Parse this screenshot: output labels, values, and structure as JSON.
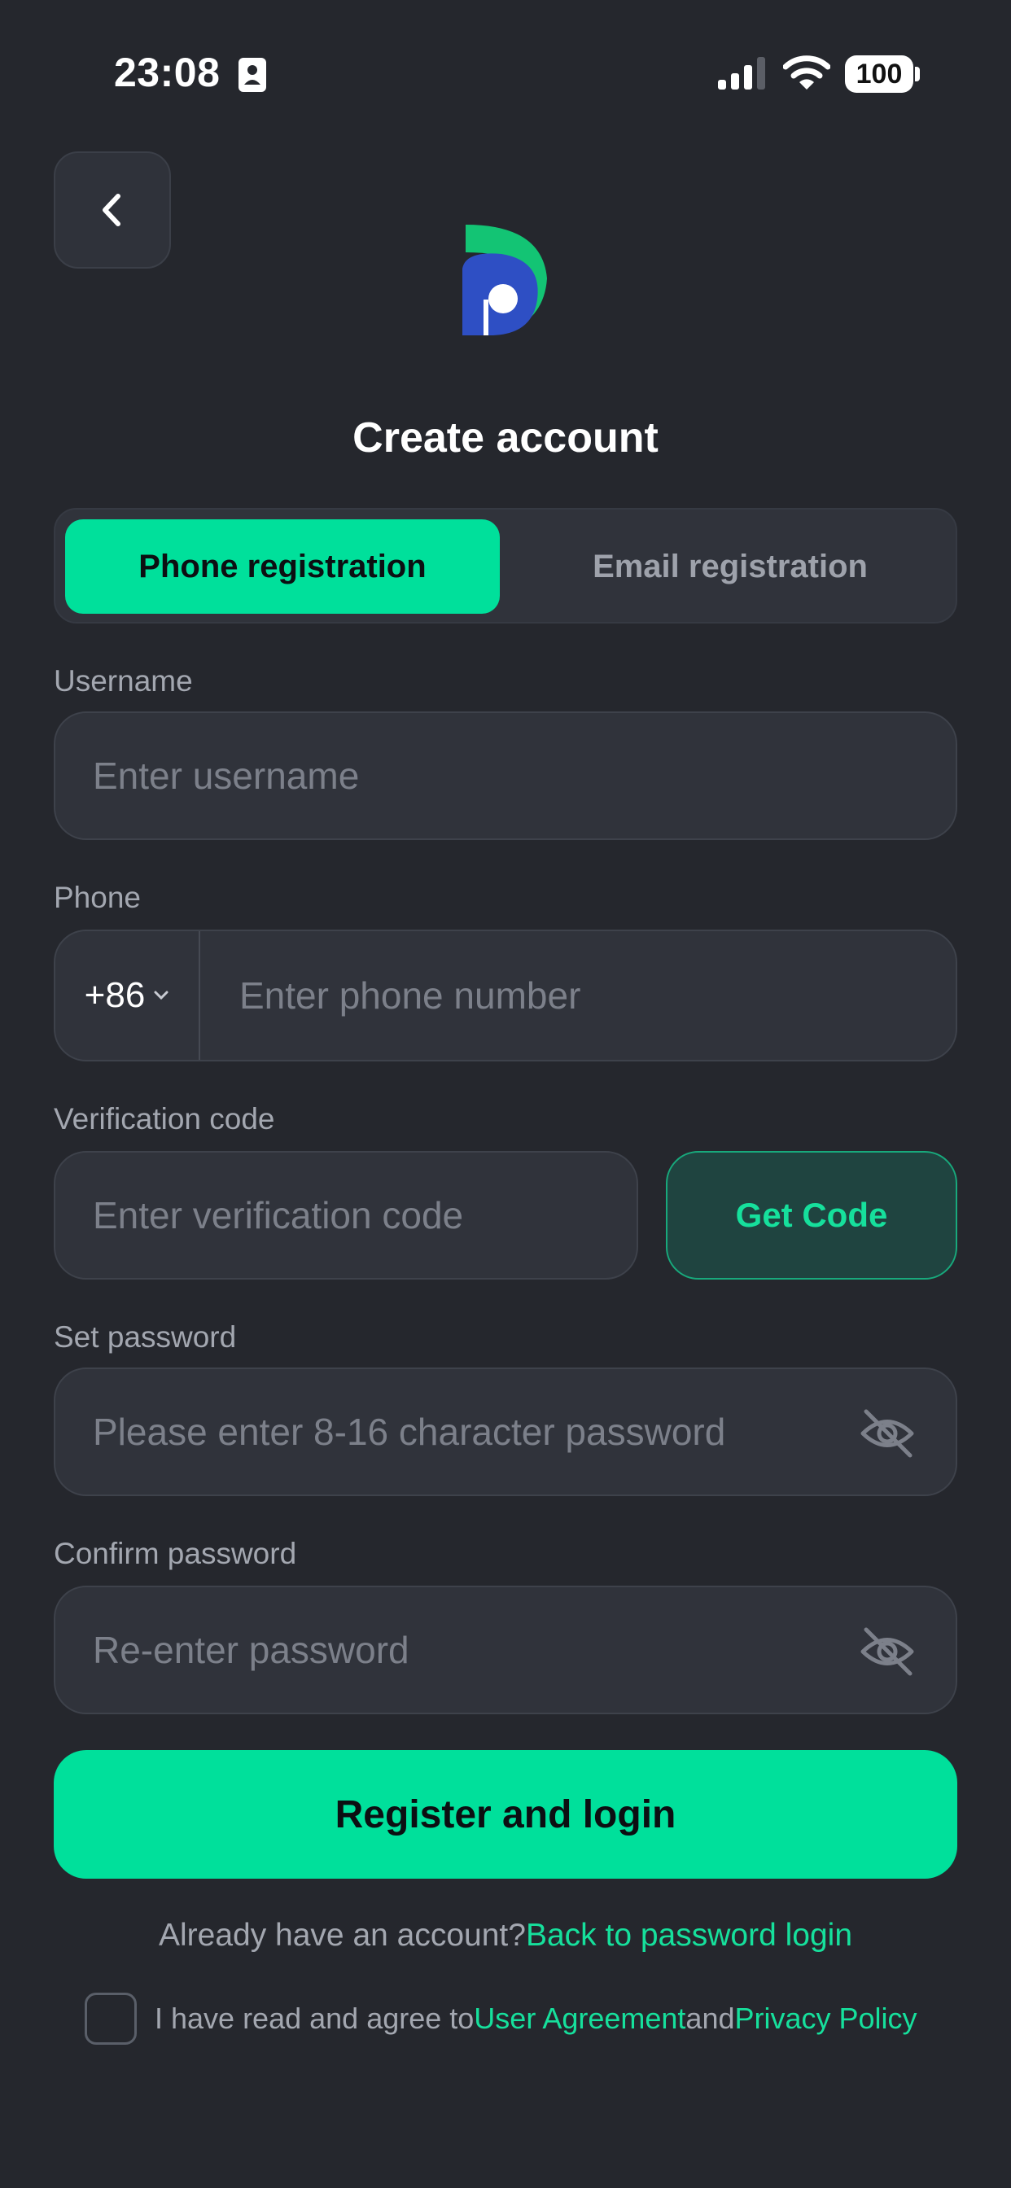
{
  "status_bar": {
    "time": "23:08",
    "battery": "100"
  },
  "header": {
    "title": "Create account",
    "back_icon": "chevron-left-icon"
  },
  "tabs": [
    {
      "label": "Phone registration",
      "active": true
    },
    {
      "label": "Email registration",
      "active": false
    }
  ],
  "form": {
    "username": {
      "label": "Username",
      "placeholder": "Enter username"
    },
    "phone": {
      "label": "Phone",
      "country_code": "+86",
      "placeholder": "Enter phone number"
    },
    "verification": {
      "label": "Verification code",
      "placeholder": "Enter verification code",
      "button": "Get Code"
    },
    "password": {
      "label": "Set password",
      "placeholder": "Please enter 8-16 character password"
    },
    "confirm_password": {
      "label": "Confirm password",
      "placeholder": "Re-enter password"
    }
  },
  "submit": {
    "label": "Register and login"
  },
  "login_prompt": {
    "text": "Already have an account?",
    "link": "Back to password login"
  },
  "agreement": {
    "checked": false,
    "prefix": "I have read and agree to",
    "user_agreement": "User Agreement",
    "conjunction": "and",
    "privacy_policy": "Privacy Policy"
  },
  "colors": {
    "background": "#25272d",
    "accent": "#00e09b",
    "field": "#30333b"
  }
}
